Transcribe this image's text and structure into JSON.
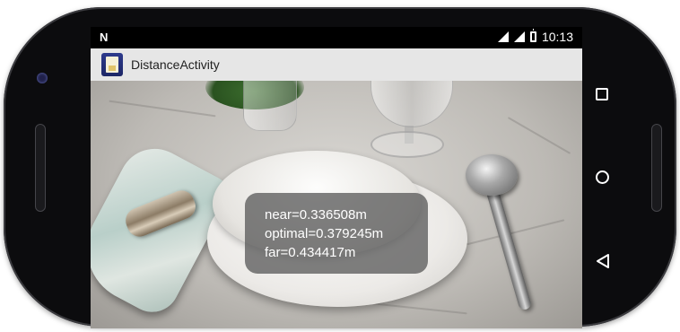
{
  "status_bar": {
    "notification_icon": "N",
    "time": "10:13",
    "icons": [
      "signal-icon",
      "signal-icon",
      "battery-icon"
    ]
  },
  "app_bar": {
    "title": "DistanceActivity",
    "icon": "app-icon"
  },
  "overlay": {
    "near": "near=0.336508m",
    "optimal": "optimal=0.379245m",
    "far": "far=0.434417m"
  },
  "nav_bar": {
    "buttons": [
      "recents-square-icon",
      "home-circle-icon",
      "back-triangle-icon"
    ]
  },
  "colors": {
    "app_bar_bg": "#e6e6e6",
    "overlay_bg": "#5c5c5c",
    "phone_body": "#0c0c0e"
  }
}
